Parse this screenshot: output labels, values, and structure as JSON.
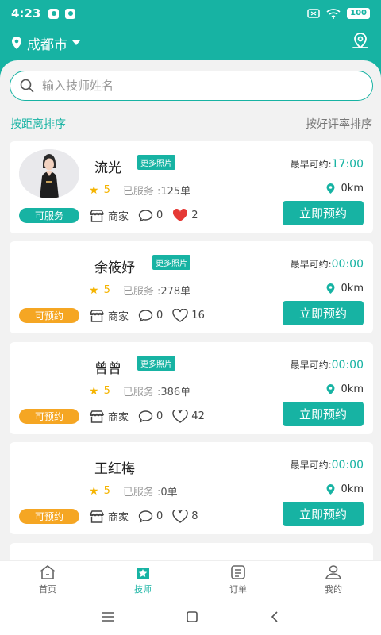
{
  "status_bar": {
    "time": "4:23",
    "battery": "100"
  },
  "header": {
    "city": "成都市"
  },
  "search": {
    "placeholder": "输入技师姓名"
  },
  "sort": {
    "by_distance": "按距离排序",
    "by_rating": "按好评率排序"
  },
  "labels": {
    "more_photos": "更多照片",
    "earliest_prefix": "最早可约:",
    "served_prefix": "已服务 :",
    "merchant": "商家",
    "book": "立即预约"
  },
  "technicians": [
    {
      "name": "流光",
      "earliest": "17:00",
      "rating": "5",
      "served": "125单",
      "distance": "0km",
      "status": "可服务",
      "status_color": "#17b3a3",
      "comments": "0",
      "likes": "2",
      "liked": true,
      "has_photo": true,
      "more_photos": true
    },
    {
      "name": "余筱妤",
      "earliest": "00:00",
      "rating": "5",
      "served": "278单",
      "distance": "0km",
      "status": "可预约",
      "status_color": "#f5a623",
      "comments": "0",
      "likes": "16",
      "liked": false,
      "has_photo": false,
      "more_photos": true
    },
    {
      "name": "曾曾",
      "earliest": "00:00",
      "rating": "5",
      "served": "386单",
      "distance": "0km",
      "status": "可预约",
      "status_color": "#f5a623",
      "comments": "0",
      "likes": "42",
      "liked": false,
      "has_photo": false,
      "more_photos": true
    },
    {
      "name": "王红梅",
      "earliest": "00:00",
      "rating": "5",
      "served": "0单",
      "distance": "0km",
      "status": "可预约",
      "status_color": "#f5a623",
      "comments": "0",
      "likes": "8",
      "liked": false,
      "has_photo": false,
      "more_photos": false
    }
  ],
  "tabs": [
    {
      "label": "首页",
      "icon": "home-icon"
    },
    {
      "label": "技师",
      "icon": "technician-icon",
      "active": true
    },
    {
      "label": "订单",
      "icon": "order-icon"
    },
    {
      "label": "我的",
      "icon": "profile-icon"
    }
  ],
  "colors": {
    "accent": "#17b3a3",
    "orange": "#f5a623",
    "heart": "#e53935"
  }
}
